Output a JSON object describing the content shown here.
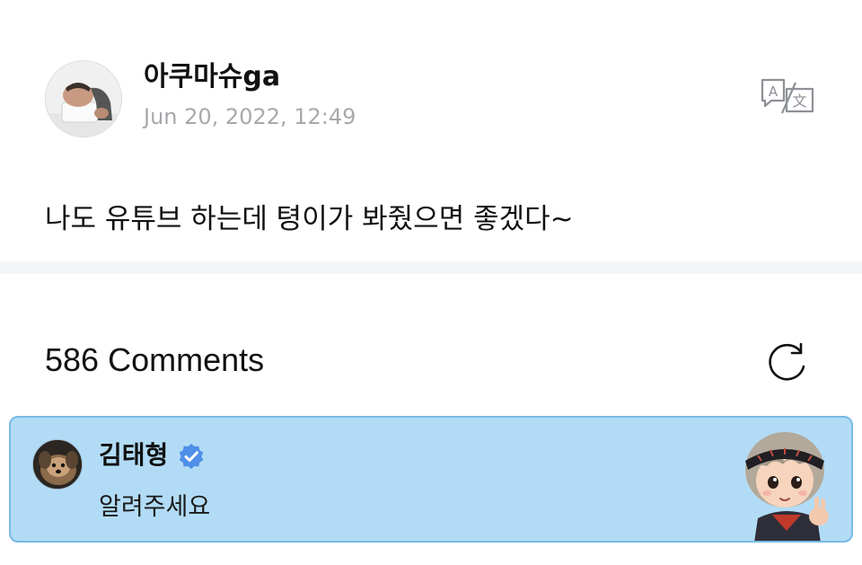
{
  "post": {
    "author_name": "아쿠마슈ga",
    "date": "Jun 20, 2022, 12:49",
    "text": "나도 유튜브 하는데 텽이가 봐줬으면 좋겠다~",
    "avatar_icon": "user-photo-avatar",
    "translate_icon": "translate-icon"
  },
  "comments": {
    "count_label": "586 Comments",
    "refresh_icon": "refresh-icon",
    "items": [
      {
        "author": "김태형",
        "verified": true,
        "text": "알려주세요",
        "avatar_icon": "dog-photo-avatar",
        "sticker_icon": "character-sticker",
        "highlight_color": "#b2dcf6",
        "badge_color": "#4f8fe8"
      }
    ]
  }
}
